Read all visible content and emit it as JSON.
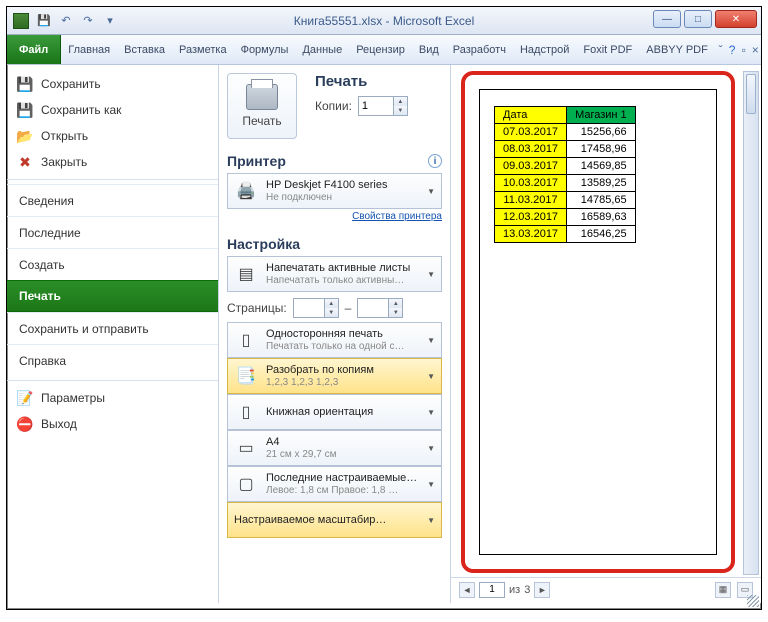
{
  "window": {
    "title": "Книга55551.xlsx - Microsoft Excel"
  },
  "ribbon": {
    "file": "Файл",
    "tabs": [
      "Главная",
      "Вставка",
      "Разметка",
      "Формулы",
      "Данные",
      "Рецензир",
      "Вид",
      "Разработч",
      "Надстрой",
      "Foxit PDF",
      "ABBYY PDF"
    ]
  },
  "nav": {
    "quick": [
      {
        "label": "Сохранить",
        "icon": "💾",
        "cls": "ic-save"
      },
      {
        "label": "Сохранить как",
        "icon": "💾",
        "cls": "ic-save"
      },
      {
        "label": "Открыть",
        "icon": "📂",
        "cls": "ic-open"
      },
      {
        "label": "Закрыть",
        "icon": "✖",
        "cls": "ic-close"
      }
    ],
    "items": [
      "Сведения",
      "Последние",
      "Создать",
      "Печать",
      "Сохранить и отправить",
      "Справка"
    ],
    "active_index": 3,
    "bottom": [
      {
        "label": "Параметры",
        "icon": "📝"
      },
      {
        "label": "Выход",
        "icon": "⛔"
      }
    ]
  },
  "print": {
    "title": "Печать",
    "button": "Печать",
    "copies_label": "Копии:",
    "copies_value": "1",
    "printer_title": "Принтер",
    "printer_name": "HP Deskjet F4100 series",
    "printer_status": "Не подключен",
    "printer_props": "Свойства принтера",
    "settings_title": "Настройка",
    "pages_label": "Страницы:",
    "pages_sep": "–",
    "dd": [
      {
        "t1": "Напечатать активные листы",
        "t2": "Напечатать только активны…"
      },
      {
        "t1": "Односторонняя печать",
        "t2": "Печатать только на одной с…"
      },
      {
        "t1": "Разобрать по копиям",
        "t2": "1,2,3   1,2,3   1,2,3"
      },
      {
        "t1": "Книжная ориентация",
        "t2": ""
      },
      {
        "t1": "A4",
        "t2": "21 см x 29,7 см"
      },
      {
        "t1": "Последние настраиваемые …",
        "t2": "Левое: 1,8 см   Правое: 1,8 …"
      },
      {
        "t1": "Настраиваемое масштабир…",
        "t2": ""
      }
    ]
  },
  "preview": {
    "headers": [
      "Дата",
      "Магазин 1"
    ],
    "rows": [
      [
        "07.03.2017",
        "15256,66"
      ],
      [
        "08.03.2017",
        "17458,96"
      ],
      [
        "09.03.2017",
        "14569,85"
      ],
      [
        "10.03.2017",
        "13589,25"
      ],
      [
        "11.03.2017",
        "14785,65"
      ],
      [
        "12.03.2017",
        "16589,63"
      ],
      [
        "13.03.2017",
        "16546,25"
      ]
    ],
    "page_current": "1",
    "page_sep": "из",
    "page_total": "3"
  }
}
